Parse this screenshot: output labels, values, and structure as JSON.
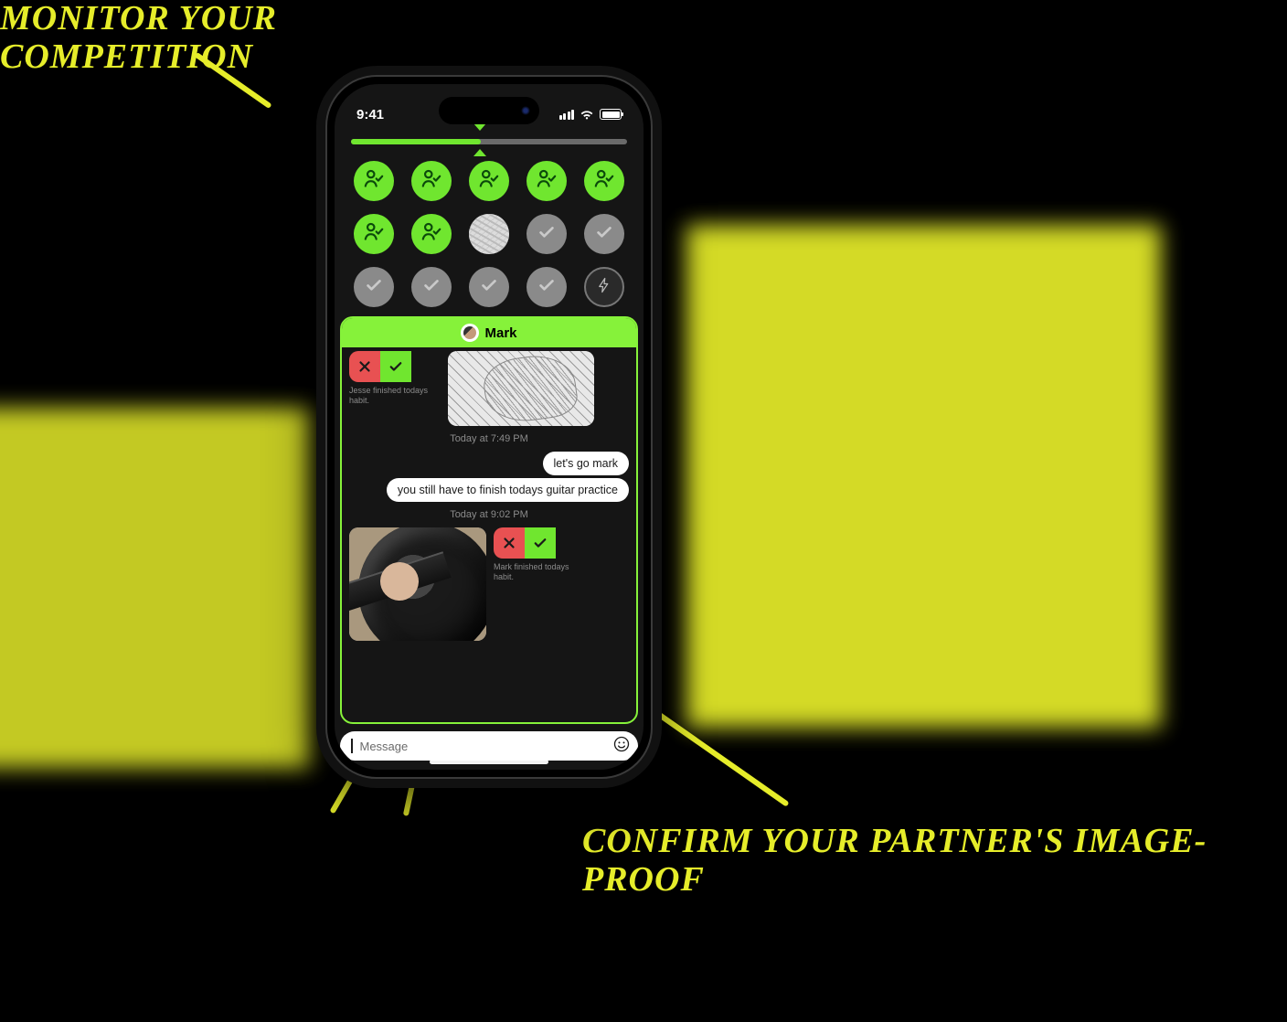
{
  "annotations": {
    "top": "Monitor Your Competition",
    "bottom": "Confirm your Partner's Image-Proof"
  },
  "statusbar": {
    "time": "9:41"
  },
  "progress": {
    "percent": 47
  },
  "day_grid": {
    "cells": [
      {
        "state": "done"
      },
      {
        "state": "done"
      },
      {
        "state": "done"
      },
      {
        "state": "done"
      },
      {
        "state": "done"
      },
      {
        "state": "done"
      },
      {
        "state": "done"
      },
      {
        "state": "today"
      },
      {
        "state": "pending"
      },
      {
        "state": "pending"
      },
      {
        "state": "pending"
      },
      {
        "state": "pending"
      },
      {
        "state": "pending"
      },
      {
        "state": "pending"
      },
      {
        "state": "bolt"
      }
    ]
  },
  "chat": {
    "partner_name": "Mark",
    "proof1": {
      "caption": "Jesse finished todays habit."
    },
    "timestamp1": "Today at 7:49 PM",
    "msg1": "let's go mark",
    "msg2": "you still have to finish todays guitar practice",
    "timestamp2": "Today at 9:02 PM",
    "proof2": {
      "caption": "Mark finished todays habit."
    }
  },
  "input": {
    "placeholder": "Message"
  }
}
